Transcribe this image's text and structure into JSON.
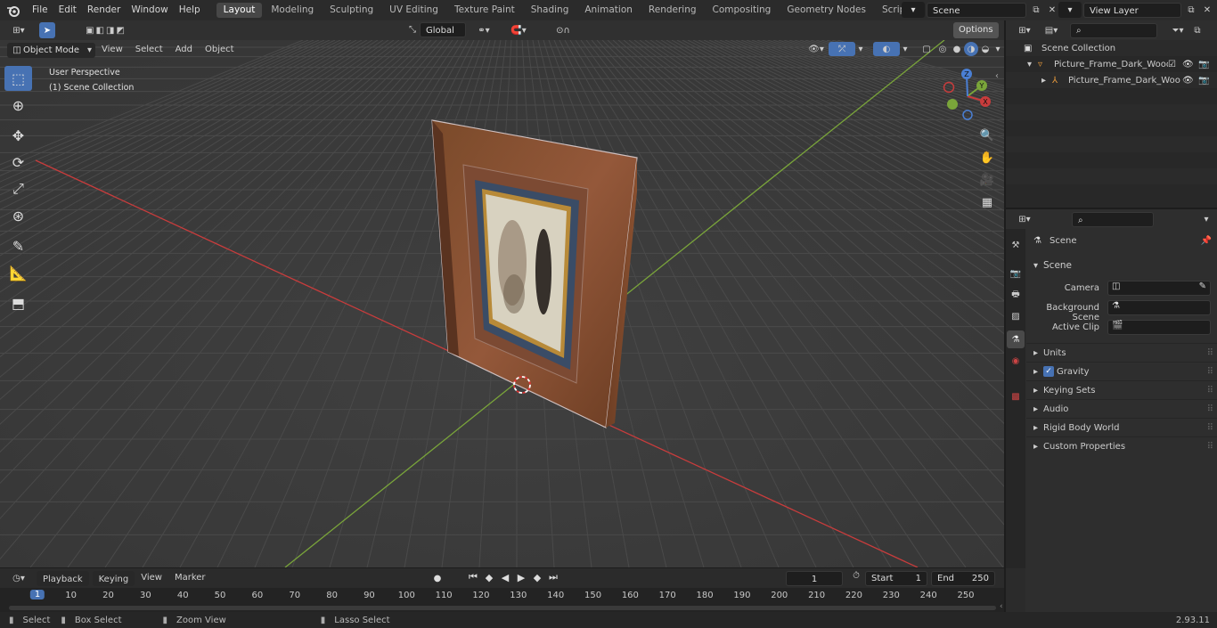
{
  "top_menu": [
    "File",
    "Edit",
    "Render",
    "Window",
    "Help"
  ],
  "workspaces": [
    {
      "label": "Layout",
      "active": true
    },
    {
      "label": "Modeling",
      "active": false
    },
    {
      "label": "Sculpting",
      "active": false
    },
    {
      "label": "UV Editing",
      "active": false
    },
    {
      "label": "Texture Paint",
      "active": false
    },
    {
      "label": "Shading",
      "active": false
    },
    {
      "label": "Animation",
      "active": false
    },
    {
      "label": "Rendering",
      "active": false
    },
    {
      "label": "Compositing",
      "active": false
    },
    {
      "label": "Geometry Nodes",
      "active": false
    },
    {
      "label": "Scripting",
      "active": false
    }
  ],
  "scene_name": "Scene",
  "view_layer": "View Layer",
  "viewport_header": {
    "mode": "Object Mode",
    "menus": [
      "View",
      "Select",
      "Add",
      "Object"
    ],
    "orientation": "Global",
    "options": "Options"
  },
  "viewport": {
    "perspective": "User Perspective",
    "collection": "(1) Scene Collection",
    "gizmo_axes": {
      "x": "X",
      "y": "Y",
      "z": "Z"
    }
  },
  "outliner": {
    "root": "Scene Collection",
    "items": [
      {
        "label": "Picture_Frame_Dark_Wood_w"
      },
      {
        "label": "Picture_Frame_Dark_Woo"
      }
    ]
  },
  "properties": {
    "context": "Scene",
    "panel": "Scene",
    "fields": [
      {
        "label": "Camera"
      },
      {
        "label": "Background Scene"
      },
      {
        "label": "Active Clip"
      }
    ],
    "sections": [
      "Units",
      "Gravity",
      "Keying Sets",
      "Audio",
      "Rigid Body World",
      "Custom Properties"
    ]
  },
  "timeline": {
    "menus": [
      "Playback",
      "Keying",
      "View",
      "Marker"
    ],
    "current_frame": "1",
    "start_label": "Start",
    "start": "1",
    "end_label": "End",
    "end": "250",
    "ruler": [
      "1",
      "10",
      "20",
      "30",
      "40",
      "50",
      "60",
      "70",
      "80",
      "90",
      "100",
      "110",
      "120",
      "130",
      "140",
      "150",
      "160",
      "170",
      "180",
      "190",
      "200",
      "210",
      "220",
      "230",
      "240",
      "250"
    ]
  },
  "status": {
    "items": [
      "Select",
      "Box Select",
      "Zoom View",
      "Lasso Select"
    ],
    "version": "2.93.11"
  },
  "colors": {
    "accent": "#4772b3",
    "x_axis": "#c83c3c",
    "y_axis": "#7aa53a",
    "bg": "#3d3d3d"
  }
}
